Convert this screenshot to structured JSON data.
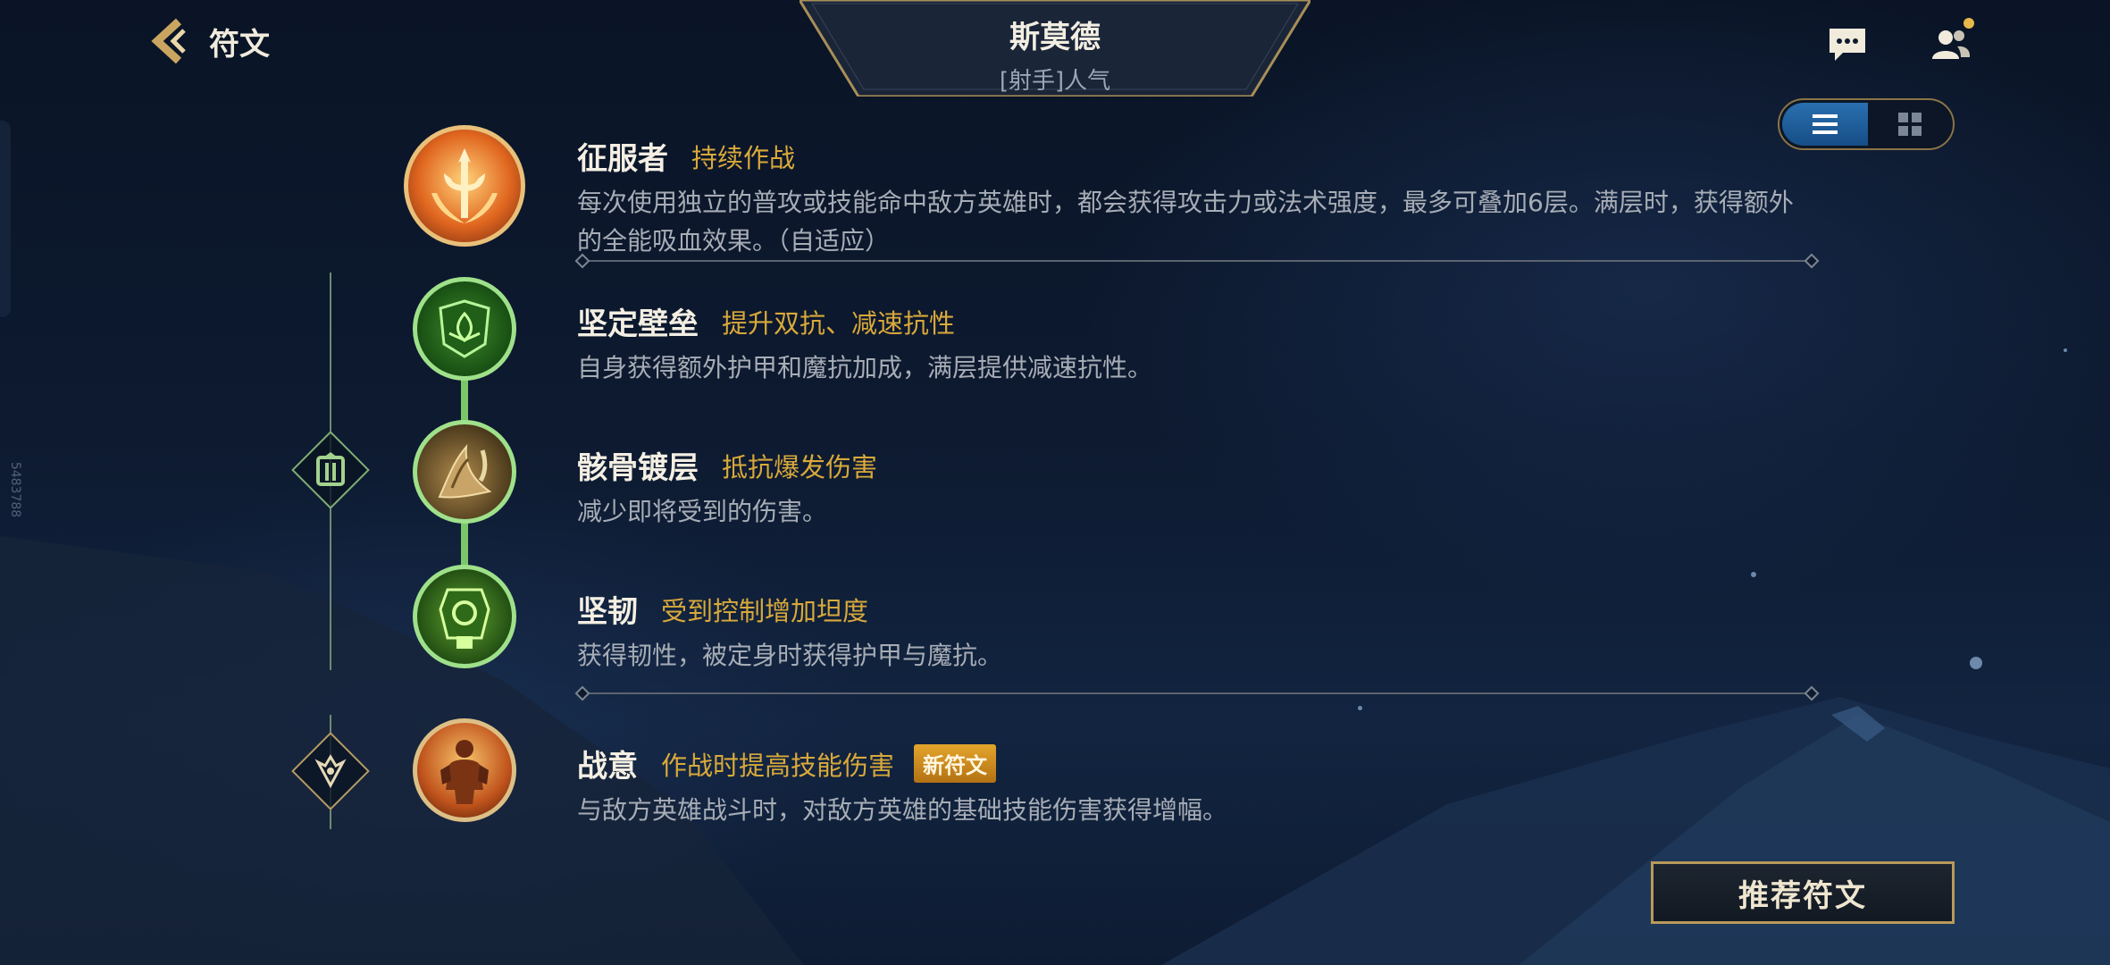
{
  "nav": {
    "back_label": "符文"
  },
  "hero": {
    "name": "斯莫德",
    "subtitle": "[射手]人气"
  },
  "top_icons": [
    "chat-icon",
    "friends-icon"
  ],
  "view_toggle": {
    "options": [
      "list-icon",
      "grid-icon"
    ],
    "selected": "list-icon"
  },
  "side_id": "5483788",
  "runes": [
    {
      "name": "征服者",
      "tag": "持续作战",
      "desc": "每次使用独立的普攻或技能命中敌方英雄时，都会获得攻击力或法术强度，最多可叠加6层。满层时，获得额外的全能吸血效果。（自适应）"
    },
    {
      "name": "坚定壁垒",
      "tag": "提升双抗、减速抗性",
      "desc": "自身获得额外护甲和魔抗加成，满层提供减速抗性。"
    },
    {
      "name": "骸骨镀层",
      "tag": "抵抗爆发伤害",
      "desc": "减少即将受到的伤害。"
    },
    {
      "name": "坚韧",
      "tag": "受到控制增加坦度",
      "desc": "获得韧性，被定身时获得护甲与魔抗。"
    },
    {
      "name": "战意",
      "tag": "作战时提高技能伤害",
      "badge": "新符文",
      "desc": "与敌方英雄战斗时，对敌方英雄的基础技能伤害获得增幅。"
    }
  ],
  "recommend_label": "推荐符文",
  "colors": {
    "gold": "#d9a93a",
    "green": "#7cc66a",
    "accent_blue": "#2a6fb0"
  }
}
